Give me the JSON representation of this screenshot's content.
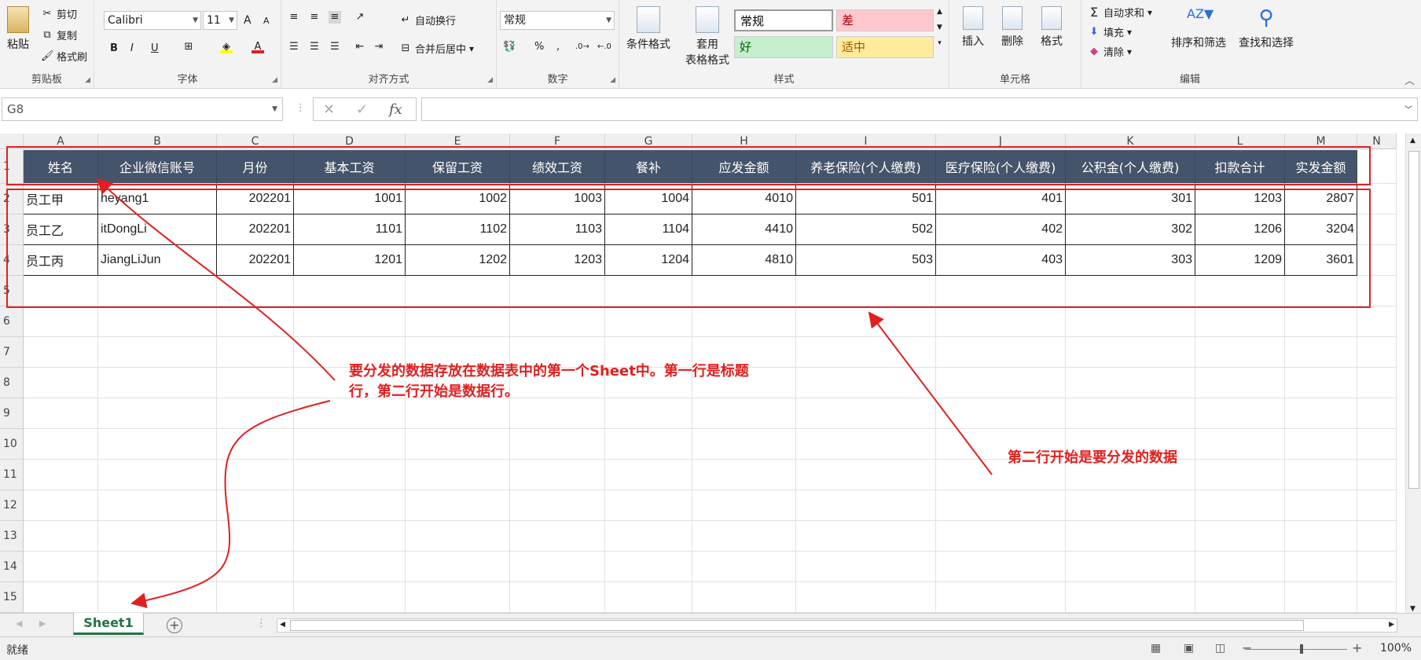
{
  "ribbon": {
    "clipboard": {
      "label": "剪贴板",
      "paste": "粘贴",
      "cut": "剪切",
      "copy": "复制",
      "format_painter": "格式刷"
    },
    "font": {
      "label": "字体",
      "name": "Calibri",
      "size": "11",
      "bold": "B",
      "italic": "I",
      "underline": "U",
      "grow": "A",
      "shrink": "A"
    },
    "alignment": {
      "label": "对齐方式",
      "wrap": "自动换行",
      "merge": "合并后居中"
    },
    "number": {
      "label": "数字",
      "format": "常规",
      "percent": "%",
      "comma": ","
    },
    "styles": {
      "label": "样式",
      "conditional": "条件格式",
      "table_format_1": "套用",
      "table_format_2": "表格格式",
      "normal": "常规",
      "bad": "差",
      "good": "好",
      "neutral": "适中"
    },
    "cells": {
      "label": "单元格",
      "insert": "插入",
      "delete": "删除",
      "format": "格式"
    },
    "editing": {
      "label": "编辑",
      "autosum": "自动求和",
      "fill": "填充",
      "clear": "清除",
      "sort": "排序和筛选",
      "find": "查找和选择"
    }
  },
  "formula_bar": {
    "name_box": "G8",
    "fx": "fx",
    "value": ""
  },
  "columns": [
    "A",
    "B",
    "C",
    "D",
    "E",
    "F",
    "G",
    "H",
    "I",
    "J",
    "K",
    "L",
    "M",
    "N"
  ],
  "rows": [
    "1",
    "2",
    "3",
    "4",
    "5",
    "6",
    "7",
    "8",
    "9",
    "10",
    "11",
    "12",
    "13",
    "14",
    "15"
  ],
  "headers": [
    "姓名",
    "企业微信账号",
    "月份",
    "基本工资",
    "保留工资",
    "绩效工资",
    "餐补",
    "应发金额",
    "养老保险(个人缴费)",
    "医疗保险(个人缴费)",
    "公积金(个人缴费)",
    "扣款合计",
    "实发金额"
  ],
  "data_rows": [
    [
      "员工甲",
      "heyang1",
      "202201",
      "1001",
      "1002",
      "1003",
      "1004",
      "4010",
      "501",
      "401",
      "301",
      "1203",
      "2807"
    ],
    [
      "员工乙",
      "itDongLi",
      "202201",
      "1101",
      "1102",
      "1103",
      "1104",
      "4410",
      "502",
      "402",
      "302",
      "1206",
      "3204"
    ],
    [
      "员工丙",
      "JiangLiJun",
      "202201",
      "1201",
      "1202",
      "1203",
      "1204",
      "4810",
      "503",
      "403",
      "303",
      "1209",
      "3601"
    ]
  ],
  "sheet_tab": "Sheet1",
  "status": {
    "ready": "就绪",
    "zoom": "100%"
  },
  "annotations": {
    "note1_line1": "要分发的数据存放在数据表中的第一个Sheet中。第一行是标题",
    "note1_line2": "行，第二行开始是数据行。",
    "note2": "第二行开始是要分发的数据"
  },
  "colors": {
    "header_bg": "#44546a",
    "annotation": "#e02020",
    "sheet_tab": "#217346"
  }
}
